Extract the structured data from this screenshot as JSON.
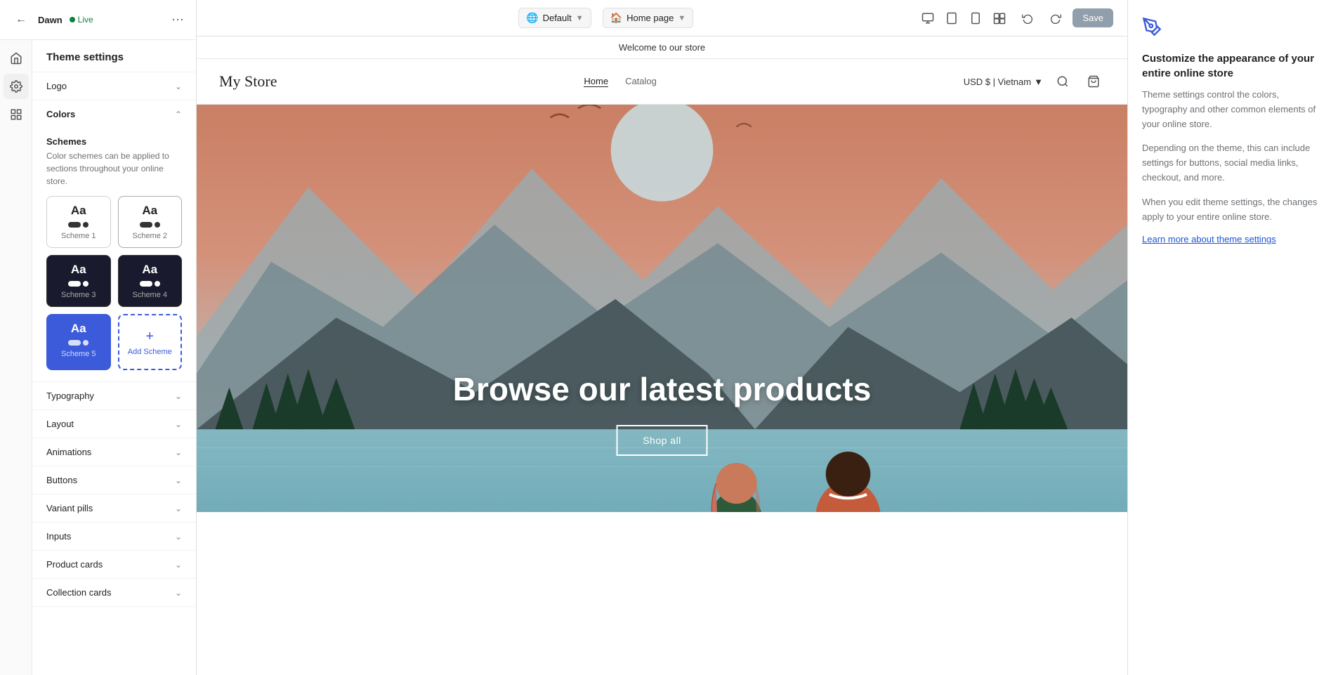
{
  "app": {
    "theme_name": "Dawn",
    "live_status": "Live"
  },
  "topbar": {
    "theme_selector_label": "Default",
    "page_selector_label": "Home page",
    "save_button": "Save"
  },
  "sidebar": {
    "title": "Theme settings",
    "sections": [
      {
        "id": "logo",
        "label": "Logo",
        "expandable": true,
        "expanded": false
      },
      {
        "id": "colors",
        "label": "Colors",
        "expandable": true,
        "expanded": true
      },
      {
        "id": "typography",
        "label": "Typography",
        "expandable": true,
        "expanded": false
      },
      {
        "id": "layout",
        "label": "Layout",
        "expandable": true,
        "expanded": false
      },
      {
        "id": "animations",
        "label": "Animations",
        "expandable": true,
        "expanded": false
      },
      {
        "id": "buttons",
        "label": "Buttons",
        "expandable": true,
        "expanded": false
      },
      {
        "id": "variant_pills",
        "label": "Variant pills",
        "expandable": true,
        "expanded": false
      },
      {
        "id": "inputs",
        "label": "Inputs",
        "expandable": true,
        "expanded": false
      },
      {
        "id": "product_cards",
        "label": "Product cards",
        "expandable": true,
        "expanded": false
      },
      {
        "id": "collection_cards",
        "label": "Collection cards",
        "expandable": true,
        "expanded": false
      }
    ],
    "colors": {
      "schemes_title": "Schemes",
      "schemes_desc": "Color schemes can be applied to sections throughout your online store.",
      "schemes": [
        {
          "id": 1,
          "name": "Scheme 1",
          "variant": "light"
        },
        {
          "id": 2,
          "name": "Scheme 2",
          "variant": "light-border"
        },
        {
          "id": 3,
          "name": "Scheme 3",
          "variant": "dark"
        },
        {
          "id": 4,
          "name": "Scheme 4",
          "variant": "dark"
        }
      ],
      "active_scheme": {
        "id": 5,
        "name": "Scheme 5",
        "variant": "blue"
      },
      "add_scheme_label": "Add Scheme"
    }
  },
  "preview": {
    "announcement": "Welcome to our store",
    "store_name": "My Store",
    "nav_links": [
      {
        "label": "Home",
        "active": true
      },
      {
        "label": "Catalog",
        "active": false
      }
    ],
    "currency": "USD $ | Vietnam",
    "hero_title": "Browse our latest products",
    "hero_cta": "Shop all"
  },
  "right_panel": {
    "title": "Customize the appearance of your entire online store",
    "description_1": "Theme settings control the colors, typography and other common elements of your online store.",
    "description_2": "Depending on the theme, this can include settings for buttons, social media links, checkout, and more.",
    "description_3": "When you edit theme settings, the changes apply to your entire online store.",
    "link_label": "Learn more about theme settings"
  }
}
